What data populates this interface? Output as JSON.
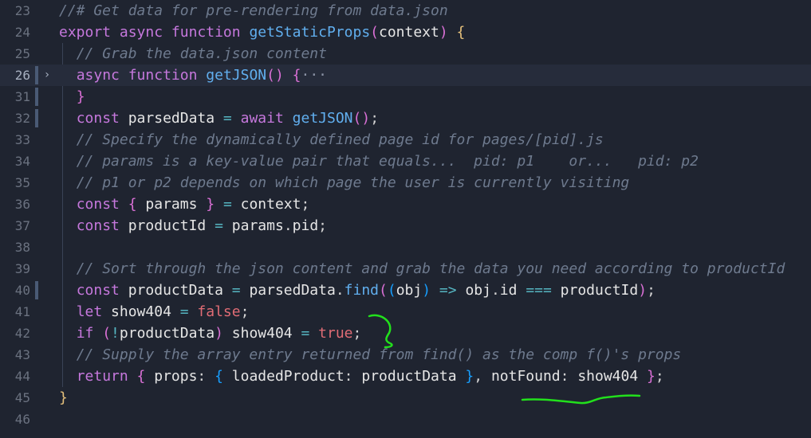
{
  "editor": {
    "lines": [
      {
        "num": "23",
        "tokens": [
          [
            "comment",
            "//# Get data for pre-rendering from data.json"
          ]
        ]
      },
      {
        "num": "24",
        "tokens": [
          [
            "storage",
            "export "
          ],
          [
            "storage",
            "async "
          ],
          [
            "storage",
            "function "
          ],
          [
            "func",
            "getStaticProps"
          ],
          [
            "brace2",
            "("
          ],
          [
            "var",
            "context"
          ],
          [
            "brace2",
            ")"
          ],
          [
            "plain",
            " "
          ],
          [
            "brace1",
            "{"
          ]
        ]
      },
      {
        "num": "25",
        "tokens": [
          [
            "plain",
            "  "
          ],
          [
            "comment",
            "// Grab the data.json content"
          ]
        ]
      },
      {
        "num": "26",
        "fold": true,
        "current": true,
        "tokens": [
          [
            "plain",
            "  "
          ],
          [
            "storage",
            "async "
          ],
          [
            "storage",
            "function "
          ],
          [
            "func",
            "getJSON"
          ],
          [
            "brace2",
            "()"
          ],
          [
            "plain",
            " "
          ],
          [
            "brace2",
            "{"
          ],
          [
            "fold",
            "···"
          ]
        ]
      },
      {
        "num": "31",
        "mark": true,
        "tokens": [
          [
            "plain",
            "  "
          ],
          [
            "brace2",
            "}"
          ]
        ]
      },
      {
        "num": "32",
        "mark": true,
        "tokens": [
          [
            "plain",
            "  "
          ],
          [
            "storage",
            "const "
          ],
          [
            "var",
            "parsedData"
          ],
          [
            "op",
            " = "
          ],
          [
            "keyword",
            "await "
          ],
          [
            "func",
            "getJSON"
          ],
          [
            "brace2",
            "()"
          ],
          [
            "plain",
            ";"
          ]
        ]
      },
      {
        "num": "33",
        "tokens": [
          [
            "plain",
            "  "
          ],
          [
            "comment",
            "// Specify the dynamically defined page id for pages/[pid].js"
          ]
        ]
      },
      {
        "num": "34",
        "tokens": [
          [
            "plain",
            "  "
          ],
          [
            "comment",
            "// params is a key-value pair that equals...  pid: p1    or...   pid: p2"
          ]
        ]
      },
      {
        "num": "35",
        "tokens": [
          [
            "plain",
            "  "
          ],
          [
            "comment",
            "// p1 or p2 depends on which page the user is currently visiting"
          ]
        ]
      },
      {
        "num": "36",
        "tokens": [
          [
            "plain",
            "  "
          ],
          [
            "storage",
            "const "
          ],
          [
            "brace2",
            "{"
          ],
          [
            "var",
            " params "
          ],
          [
            "brace2",
            "}"
          ],
          [
            "op",
            " = "
          ],
          [
            "var",
            "context"
          ],
          [
            "plain",
            ";"
          ]
        ]
      },
      {
        "num": "37",
        "tokens": [
          [
            "plain",
            "  "
          ],
          [
            "storage",
            "const "
          ],
          [
            "var",
            "productId"
          ],
          [
            "op",
            " = "
          ],
          [
            "var",
            "params"
          ],
          [
            "plain",
            "."
          ],
          [
            "var",
            "pid"
          ],
          [
            "plain",
            ";"
          ]
        ]
      },
      {
        "num": "38",
        "tokens": []
      },
      {
        "num": "39",
        "tokens": [
          [
            "plain",
            "  "
          ],
          [
            "comment",
            "// Sort through the json content and grab the data you need according to productId"
          ]
        ]
      },
      {
        "num": "40",
        "mark": true,
        "tokens": [
          [
            "plain",
            "  "
          ],
          [
            "storage",
            "const "
          ],
          [
            "var",
            "productData"
          ],
          [
            "op",
            " = "
          ],
          [
            "var",
            "parsedData"
          ],
          [
            "plain",
            "."
          ],
          [
            "func",
            "find"
          ],
          [
            "brace2",
            "("
          ],
          [
            "brace3",
            "("
          ],
          [
            "var",
            "obj"
          ],
          [
            "brace3",
            ")"
          ],
          [
            "op",
            " => "
          ],
          [
            "var",
            "obj"
          ],
          [
            "plain",
            "."
          ],
          [
            "var",
            "id"
          ],
          [
            "op",
            " === "
          ],
          [
            "var",
            "productId"
          ],
          [
            "brace2",
            ")"
          ],
          [
            "plain",
            ";"
          ]
        ]
      },
      {
        "num": "41",
        "tokens": [
          [
            "plain",
            "  "
          ],
          [
            "storage",
            "let "
          ],
          [
            "var",
            "show404"
          ],
          [
            "op",
            " = "
          ],
          [
            "bool",
            "false"
          ],
          [
            "plain",
            ";"
          ]
        ]
      },
      {
        "num": "42",
        "tokens": [
          [
            "plain",
            "  "
          ],
          [
            "keyword",
            "if "
          ],
          [
            "brace2",
            "("
          ],
          [
            "op",
            "!"
          ],
          [
            "var",
            "productData"
          ],
          [
            "brace2",
            ")"
          ],
          [
            "var",
            " show404"
          ],
          [
            "op",
            " = "
          ],
          [
            "bool",
            "true"
          ],
          [
            "plain",
            ";"
          ]
        ]
      },
      {
        "num": "43",
        "tokens": [
          [
            "plain",
            "  "
          ],
          [
            "comment",
            "// Supply the array entry returned from find() as the comp f()'s props"
          ]
        ]
      },
      {
        "num": "44",
        "tokens": [
          [
            "plain",
            "  "
          ],
          [
            "keyword",
            "return "
          ],
          [
            "brace2",
            "{"
          ],
          [
            "var",
            " props"
          ],
          [
            "plain",
            ": "
          ],
          [
            "brace3",
            "{"
          ],
          [
            "var",
            " loadedProduct"
          ],
          [
            "plain",
            ": "
          ],
          [
            "var",
            "productData "
          ],
          [
            "brace3",
            "}"
          ],
          [
            "plain",
            ", "
          ],
          [
            "var",
            "notFound"
          ],
          [
            "plain",
            ": "
          ],
          [
            "var",
            "show404 "
          ],
          [
            "brace2",
            "}"
          ],
          [
            "plain",
            ";"
          ]
        ]
      },
      {
        "num": "45",
        "tokens": [
          [
            "brace1",
            "}"
          ]
        ]
      },
      {
        "num": "46",
        "tokens": []
      }
    ]
  },
  "annotation_color": "#22e01c"
}
